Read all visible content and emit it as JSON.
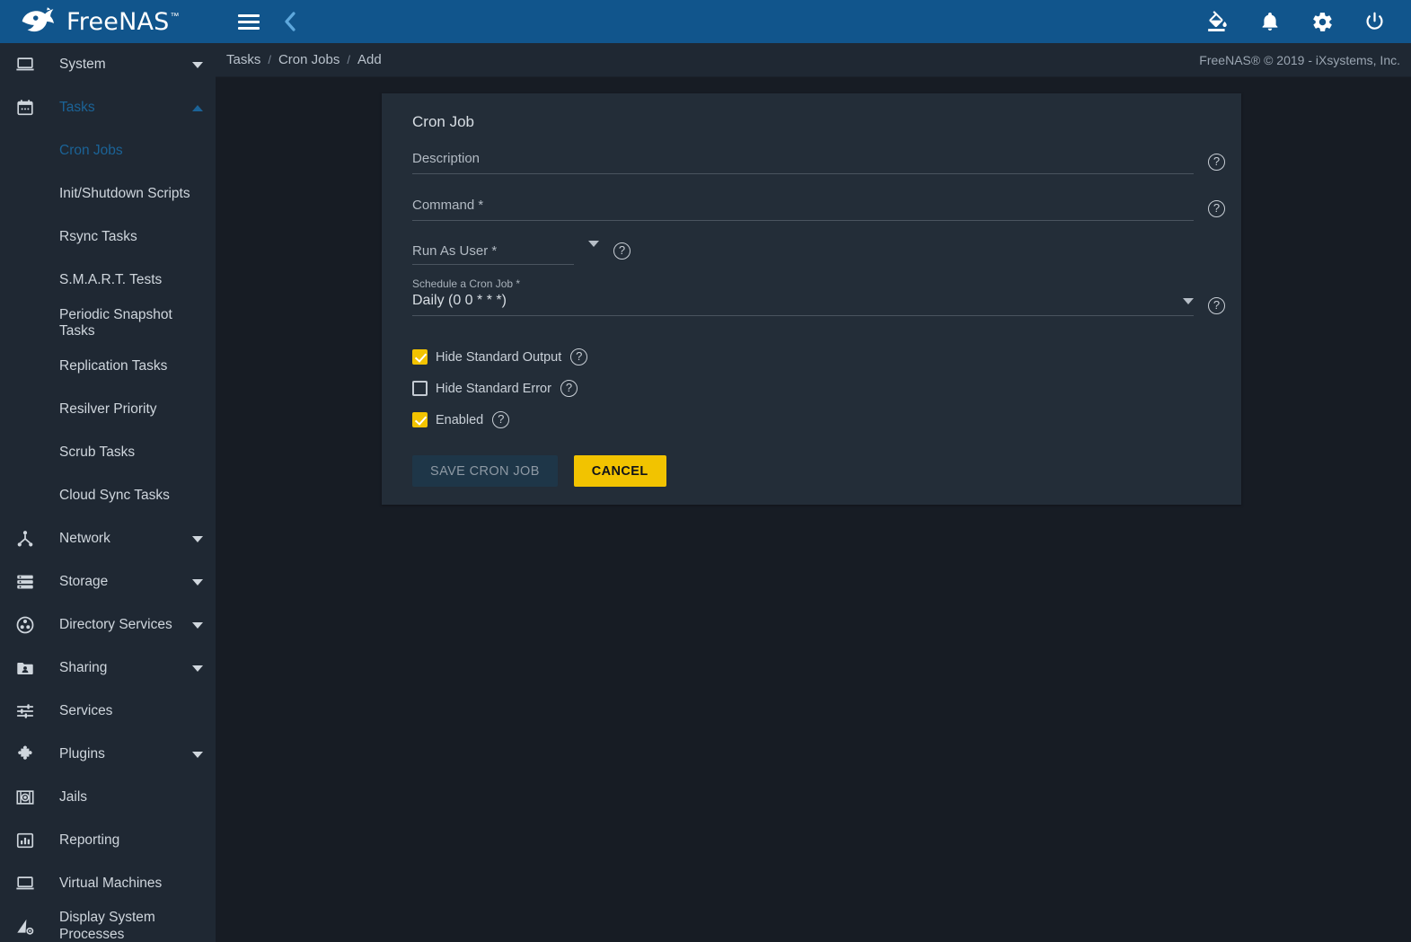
{
  "brand": {
    "name": "FreeNAS",
    "trademark": "™",
    "logo_icon": "freenas-fish-logo"
  },
  "topbar": {
    "menu_toggle_icon": "hamburger-menu-icon",
    "back_icon": "chevron-left-icon",
    "theme_icon": "paint-bucket-icon",
    "alerts_icon": "bell-icon",
    "settings_icon": "gear-icon",
    "power_icon": "power-icon"
  },
  "breadcrumb": {
    "items": [
      "Tasks",
      "Cron Jobs",
      "Add"
    ],
    "separator": "/",
    "copyright": "FreeNAS® © 2019 - iXsystems, Inc."
  },
  "sidebar": {
    "items": [
      {
        "label": "System",
        "icon": "laptop-icon",
        "expandable": true,
        "expanded": false,
        "level": "top",
        "active": false
      },
      {
        "label": "Tasks",
        "icon": "calendar-icon",
        "expandable": true,
        "expanded": true,
        "level": "top",
        "active": true
      },
      {
        "label": "Cron Jobs",
        "icon": "",
        "expandable": false,
        "level": "sub",
        "active": true
      },
      {
        "label": "Init/Shutdown Scripts",
        "icon": "",
        "expandable": false,
        "level": "sub",
        "active": false
      },
      {
        "label": "Rsync Tasks",
        "icon": "",
        "expandable": false,
        "level": "sub",
        "active": false
      },
      {
        "label": "S.M.A.R.T. Tests",
        "icon": "",
        "expandable": false,
        "level": "sub",
        "active": false
      },
      {
        "label": "Periodic Snapshot Tasks",
        "icon": "",
        "expandable": false,
        "level": "sub",
        "active": false
      },
      {
        "label": "Replication Tasks",
        "icon": "",
        "expandable": false,
        "level": "sub",
        "active": false
      },
      {
        "label": "Resilver Priority",
        "icon": "",
        "expandable": false,
        "level": "sub",
        "active": false
      },
      {
        "label": "Scrub Tasks",
        "icon": "",
        "expandable": false,
        "level": "sub",
        "active": false
      },
      {
        "label": "Cloud Sync Tasks",
        "icon": "",
        "expandable": false,
        "level": "sub",
        "active": false
      },
      {
        "label": "Network",
        "icon": "network-icon",
        "expandable": true,
        "expanded": false,
        "level": "top",
        "active": false
      },
      {
        "label": "Storage",
        "icon": "storage-stack-icon",
        "expandable": true,
        "expanded": false,
        "level": "top",
        "active": false
      },
      {
        "label": "Directory Services",
        "icon": "directory-services-icon",
        "expandable": true,
        "expanded": false,
        "level": "top",
        "active": false
      },
      {
        "label": "Sharing",
        "icon": "sharing-folder-icon",
        "expandable": true,
        "expanded": false,
        "level": "top",
        "active": false
      },
      {
        "label": "Services",
        "icon": "sliders-icon",
        "expandable": false,
        "level": "top",
        "active": false
      },
      {
        "label": "Plugins",
        "icon": "puzzle-piece-icon",
        "expandable": true,
        "expanded": false,
        "level": "top",
        "active": false
      },
      {
        "label": "Jails",
        "icon": "jail-icon",
        "expandable": false,
        "level": "top",
        "active": false
      },
      {
        "label": "Reporting",
        "icon": "bar-chart-icon",
        "expandable": false,
        "level": "top",
        "active": false
      },
      {
        "label": "Virtual Machines",
        "icon": "laptop-icon",
        "expandable": false,
        "level": "top",
        "active": false
      },
      {
        "label": "Display System Processes",
        "icon": "processes-icon",
        "expandable": false,
        "level": "top",
        "active": false
      }
    ]
  },
  "form": {
    "title": "Cron Job",
    "description": {
      "label": "Description",
      "value": "",
      "help_icon": "help-circle-icon"
    },
    "command": {
      "label": "Command *",
      "value": "",
      "help_icon": "help-circle-icon"
    },
    "run_as_user": {
      "label": "Run As User *",
      "value": "",
      "help_icon": "help-circle-icon",
      "caret_icon": "chevron-down-icon"
    },
    "schedule": {
      "label": "Schedule a Cron Job *",
      "value": "Daily (0 0 * * *)",
      "help_icon": "help-circle-icon",
      "caret_icon": "chevron-down-icon"
    },
    "checkboxes": [
      {
        "label": "Hide Standard Output",
        "checked": true,
        "help_icon": "help-circle-icon"
      },
      {
        "label": "Hide Standard Error",
        "checked": false,
        "help_icon": "help-circle-icon"
      },
      {
        "label": "Enabled",
        "checked": true,
        "help_icon": "help-circle-icon"
      }
    ],
    "buttons": {
      "save": "SAVE CRON JOB",
      "save_disabled": true,
      "cancel": "CANCEL"
    }
  },
  "colors": {
    "topbar_blue": "#11558c",
    "sidebar_bg": "#1f2833",
    "page_bg": "#171c24",
    "card_bg": "#232d38",
    "accent_yellow": "#f2c300",
    "active_blue": "#1b6397",
    "text_primary": "#d7dde3",
    "text_muted": "#9aa5b1"
  }
}
